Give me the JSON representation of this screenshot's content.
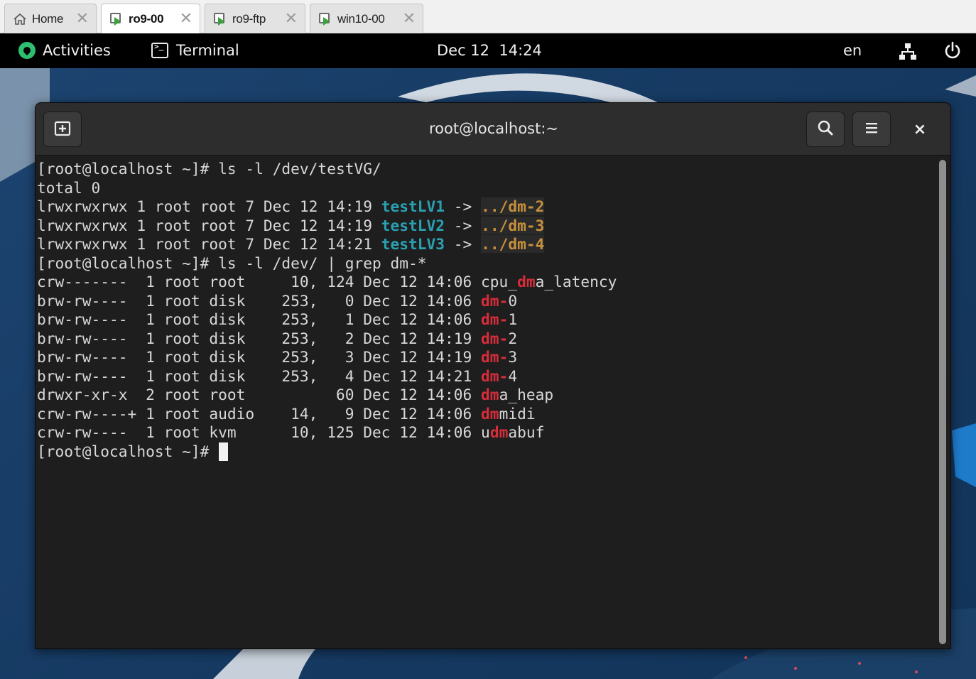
{
  "vm_tabs": [
    {
      "label": "Home",
      "icon": "home-icon",
      "active": false
    },
    {
      "label": "ro9-00",
      "icon": "vm-icon",
      "active": true
    },
    {
      "label": "ro9-ftp",
      "icon": "vm-icon",
      "active": false
    },
    {
      "label": "win10-00",
      "icon": "vm-icon",
      "active": false
    }
  ],
  "tab_close_glyph": "✕",
  "topbar": {
    "activities_label": "Activities",
    "app_name": "Terminal",
    "clock": "Dec 12  14:24",
    "language": "en",
    "network_icon": "network-icon",
    "power_icon": "power-icon"
  },
  "terminal": {
    "title": "root@localhost:~",
    "new_tab_icon": "new-tab-icon",
    "search_icon": "search-icon",
    "menu_icon": "hamburger-menu-icon",
    "close_glyph": "×",
    "lines": [
      [
        {
          "t": "[root@localhost ~]# ls -l /dev/testVG/"
        }
      ],
      [
        {
          "t": "total 0"
        }
      ],
      [
        {
          "t": "lrwxrwxrwx 1 root root 7 Dec 12 14:19 "
        },
        {
          "t": "testLV1",
          "c": "lv"
        },
        {
          "t": " -> "
        },
        {
          "t": "../dm-2",
          "c": "tgt"
        }
      ],
      [
        {
          "t": "lrwxrwxrwx 1 root root 7 Dec 12 14:19 "
        },
        {
          "t": "testLV2",
          "c": "lv"
        },
        {
          "t": " -> "
        },
        {
          "t": "../dm-3",
          "c": "tgt"
        }
      ],
      [
        {
          "t": "lrwxrwxrwx 1 root root 7 Dec 12 14:21 "
        },
        {
          "t": "testLV3",
          "c": "lv"
        },
        {
          "t": " -> "
        },
        {
          "t": "../dm-4",
          "c": "tgt"
        }
      ],
      [
        {
          "t": "[root@localhost ~]# ls -l /dev/ | grep dm-*"
        }
      ],
      [
        {
          "t": "crw-------  1 root root     10, 124 Dec 12 14:06 cpu_"
        },
        {
          "t": "dm",
          "c": "m"
        },
        {
          "t": "a_latency"
        }
      ],
      [
        {
          "t": "brw-rw----  1 root disk    253,   0 Dec 12 14:06 "
        },
        {
          "t": "dm-",
          "c": "m"
        },
        {
          "t": "0"
        }
      ],
      [
        {
          "t": "brw-rw----  1 root disk    253,   1 Dec 12 14:06 "
        },
        {
          "t": "dm-",
          "c": "m"
        },
        {
          "t": "1"
        }
      ],
      [
        {
          "t": "brw-rw----  1 root disk    253,   2 Dec 12 14:19 "
        },
        {
          "t": "dm-",
          "c": "m"
        },
        {
          "t": "2"
        }
      ],
      [
        {
          "t": "brw-rw----  1 root disk    253,   3 Dec 12 14:19 "
        },
        {
          "t": "dm-",
          "c": "m"
        },
        {
          "t": "3"
        }
      ],
      [
        {
          "t": "brw-rw----  1 root disk    253,   4 Dec 12 14:21 "
        },
        {
          "t": "dm-",
          "c": "m"
        },
        {
          "t": "4"
        }
      ],
      [
        {
          "t": "drwxr-xr-x  2 root root          60 Dec 12 14:06 "
        },
        {
          "t": "dm",
          "c": "m"
        },
        {
          "t": "a_heap"
        }
      ],
      [
        {
          "t": "crw-rw----+ 1 root audio    14,   9 Dec 12 14:06 "
        },
        {
          "t": "dm",
          "c": "m"
        },
        {
          "t": "midi"
        }
      ],
      [
        {
          "t": "crw-rw----  1 root kvm      10, 125 Dec 12 14:06 u"
        },
        {
          "t": "dm",
          "c": "m"
        },
        {
          "t": "abuf"
        }
      ],
      [
        {
          "t": "[root@localhost ~]# "
        }
      ]
    ]
  },
  "colors": {
    "lv_name": "#2aa1b3",
    "link_target": "#c7903c",
    "grep_match": "#d82d3a",
    "terminal_bg": "#1e1e1e",
    "accent_gnome": "#2fbf71"
  }
}
